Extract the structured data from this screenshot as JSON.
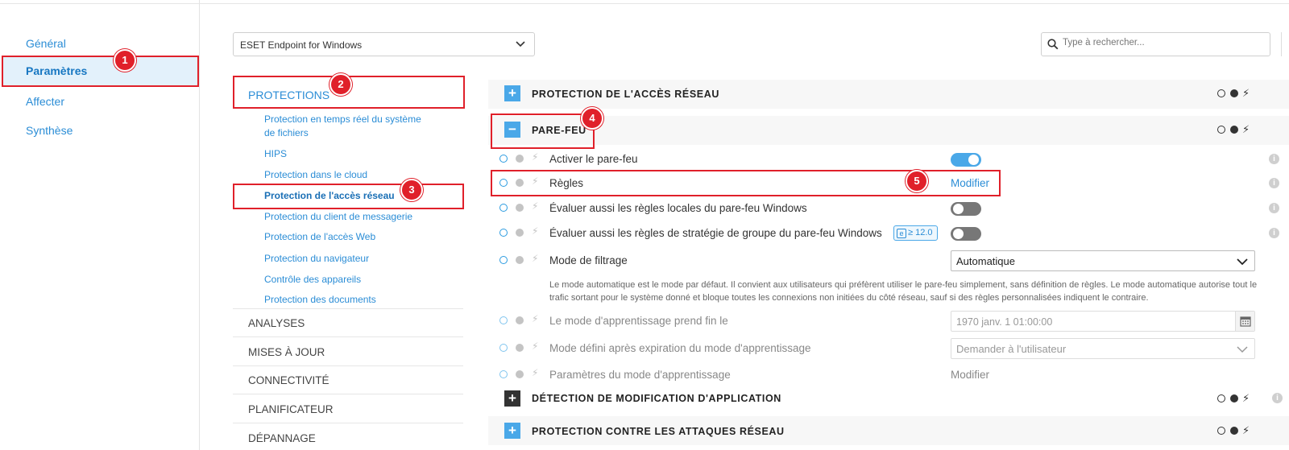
{
  "leftnav": {
    "items": [
      {
        "label": "Général"
      },
      {
        "label": "Paramètres"
      },
      {
        "label": "Affecter"
      },
      {
        "label": "Synthèse"
      }
    ]
  },
  "toolbar": {
    "product_select": "ESET Endpoint for Windows",
    "search_placeholder": "Type à rechercher..."
  },
  "sections": {
    "protections": "PROTECTIONS",
    "sub_items": [
      "Protection en temps réel du système de fichiers",
      "HIPS",
      "Protection dans le cloud",
      "Protection de l'accès réseau",
      "Protection du client de messagerie",
      "Protection de l'accès Web",
      "Protection du navigateur",
      "Contrôle des appareils",
      "Protection des documents"
    ],
    "others": [
      "ANALYSES",
      "MISES À JOUR",
      "CONNECTIVITÉ",
      "PLANIFICATEUR",
      "DÉPANNAGE"
    ]
  },
  "panel": {
    "bar_network": "PROTECTION DE L'ACCÈS RÉSEAU",
    "bar_firewall": "PARE-FEU",
    "bar_app_detect": "DÉTECTION DE MODIFICATION D'APPLICATION",
    "bar_attacks": "PROTECTION CONTRE LES ATTAQUES RÉSEAU",
    "rows": {
      "enable_fw": "Activer le pare-feu",
      "rules": "Règles",
      "rules_action": "Modifier",
      "eval_local": "Évaluer aussi les règles locales du pare-feu Windows",
      "eval_gpo": "Évaluer aussi les règles de stratégie de groupe du pare-feu Windows",
      "version_badge": "≥ 12.0",
      "filter_mode": "Mode de filtrage",
      "filter_mode_value": "Automatique",
      "filter_desc": "Le mode automatique est le mode par défaut. Il convient aux utilisateurs qui préfèrent utiliser le pare-feu simplement, sans définition de règles. Le mode automatique autorise tout le trafic sortant pour le système donné et bloque toutes les connexions non initiées du côté réseau, sauf si des règles personnalisées indiquent le contraire.",
      "learn_end": "Le mode d'apprentissage prend fin le",
      "learn_end_value": "1970 janv. 1 01:00:00",
      "after_learn": "Mode défini après expiration du mode d'apprentissage",
      "after_learn_value": "Demander à l'utilisateur",
      "learn_params": "Paramètres du mode d'apprentissage",
      "learn_params_action": "Modifier"
    }
  },
  "annotations": [
    "1",
    "2",
    "3",
    "4",
    "5"
  ],
  "colors": {
    "accent": "#2b8dd6",
    "annotation": "#e0202a",
    "toggle_on": "#4aa8e8"
  }
}
